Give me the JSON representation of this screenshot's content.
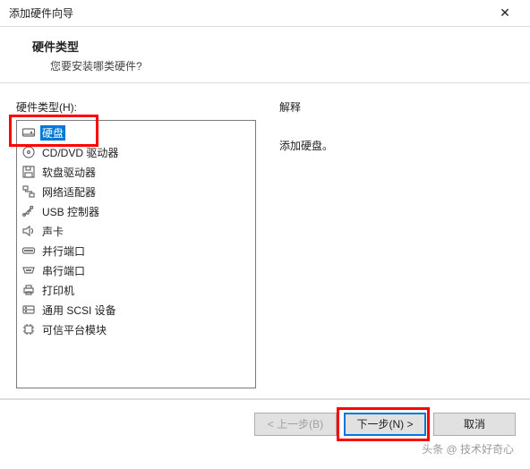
{
  "window": {
    "title": "添加硬件向导",
    "close_glyph": "✕"
  },
  "header": {
    "heading": "硬件类型",
    "subheading": "您要安装哪类硬件?"
  },
  "left": {
    "label": "硬件类型(H):",
    "items": [
      {
        "label": "硬盘",
        "icon": "harddisk-icon",
        "selected": true
      },
      {
        "label": "CD/DVD 驱动器",
        "icon": "disc-icon"
      },
      {
        "label": "软盘驱动器",
        "icon": "floppy-icon"
      },
      {
        "label": "网络适配器",
        "icon": "network-icon"
      },
      {
        "label": "USB 控制器",
        "icon": "usb-icon"
      },
      {
        "label": "声卡",
        "icon": "sound-icon"
      },
      {
        "label": "并行端口",
        "icon": "parallel-port-icon"
      },
      {
        "label": "串行端口",
        "icon": "serial-port-icon"
      },
      {
        "label": "打印机",
        "icon": "printer-icon"
      },
      {
        "label": "通用 SCSI 设备",
        "icon": "scsi-icon"
      },
      {
        "label": "可信平台模块",
        "icon": "tpm-icon"
      }
    ]
  },
  "right": {
    "label": "解释",
    "description": "添加硬盘。"
  },
  "footer": {
    "back": "< 上一步(B)",
    "next": "下一步(N) >",
    "cancel": "取消"
  },
  "watermark": "头条 @ 技术好奇心"
}
